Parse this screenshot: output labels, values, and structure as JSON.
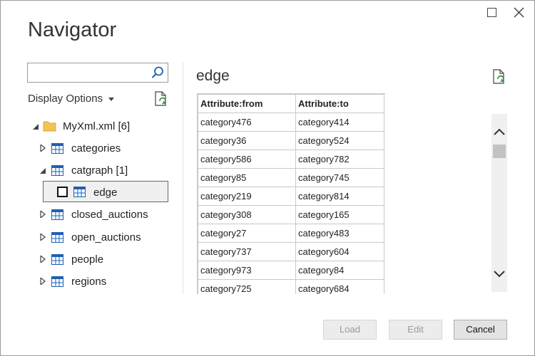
{
  "window": {
    "title": "Navigator"
  },
  "sidebar": {
    "search": {
      "value": "",
      "placeholder": ""
    },
    "display_options_label": "Display Options",
    "tree": [
      {
        "label": "MyXml.xml",
        "count": "[6]",
        "expander": "expanded",
        "icon": "folder-icon"
      },
      {
        "label": "categories",
        "count": "",
        "expander": "collapsed",
        "icon": "table-icon"
      },
      {
        "label": "catgraph",
        "count": "[1]",
        "expander": "expanded",
        "icon": "table-icon"
      },
      {
        "label": "edge",
        "count": "",
        "expander": "none",
        "icon": "table-icon",
        "selected": true,
        "checked": false
      },
      {
        "label": "closed_auctions",
        "count": "",
        "expander": "collapsed",
        "icon": "table-icon"
      },
      {
        "label": "open_auctions",
        "count": "",
        "expander": "collapsed",
        "icon": "table-icon"
      },
      {
        "label": "people",
        "count": "",
        "expander": "collapsed",
        "icon": "table-icon"
      },
      {
        "label": "regions",
        "count": "",
        "expander": "collapsed",
        "icon": "table-icon"
      }
    ]
  },
  "preview": {
    "title": "edge",
    "columns": [
      "Attribute:from",
      "Attribute:to"
    ],
    "rows": [
      [
        "category476",
        "category414"
      ],
      [
        "category36",
        "category524"
      ],
      [
        "category586",
        "category782"
      ],
      [
        "category85",
        "category745"
      ],
      [
        "category219",
        "category814"
      ],
      [
        "category308",
        "category165"
      ],
      [
        "category27",
        "category483"
      ],
      [
        "category737",
        "category604"
      ],
      [
        "category973",
        "category84"
      ],
      [
        "category725",
        "category684"
      ]
    ]
  },
  "footer": {
    "load_label": "Load",
    "edit_label": "Edit",
    "cancel_label": "Cancel"
  },
  "colors": {
    "accent_blue": "#1f5fb4",
    "refresh_green": "#2e8b3a",
    "folder_yellow": "#f2c454"
  }
}
